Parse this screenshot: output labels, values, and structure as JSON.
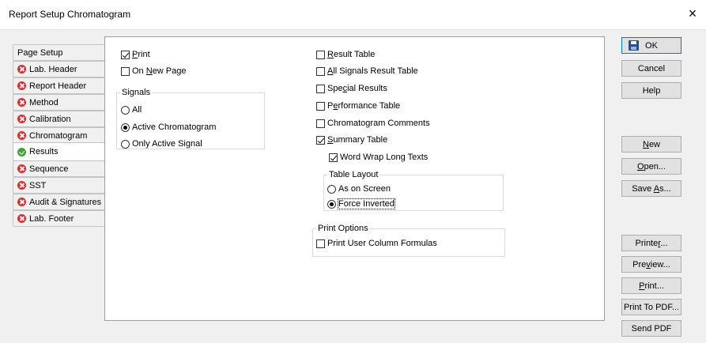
{
  "window": {
    "title": "Report Setup Chromatogram",
    "close_glyph": "×"
  },
  "tabs": [
    {
      "label": "Page Setup",
      "status": "none",
      "active": false
    },
    {
      "label": "Lab. Header",
      "status": "error",
      "active": false
    },
    {
      "label": "Report Header",
      "status": "error",
      "active": false
    },
    {
      "label": "Method",
      "status": "error",
      "active": false
    },
    {
      "label": "Calibration",
      "status": "error",
      "active": false
    },
    {
      "label": "Chromatogram",
      "status": "error",
      "active": false
    },
    {
      "label": "Results",
      "status": "ok",
      "active": true
    },
    {
      "label": "Sequence",
      "status": "error",
      "active": false
    },
    {
      "label": "SST",
      "status": "error",
      "active": false
    },
    {
      "label": "Audit & Signatures",
      "status": "error",
      "active": false
    },
    {
      "label": "Lab. Footer",
      "status": "error",
      "active": false
    }
  ],
  "left_options": {
    "print": {
      "label_u": "P",
      "label_rest": "rint",
      "checked": true
    },
    "on_new_page": {
      "label_pre": "On ",
      "label_u": "N",
      "label_rest": "ew Page",
      "checked": false
    }
  },
  "signals": {
    "title": "Signals",
    "options": [
      {
        "label": "All",
        "selected": false
      },
      {
        "label": "Active Chromatogram",
        "selected": true
      },
      {
        "label": "Only Active Signal",
        "selected": false
      }
    ]
  },
  "right_options": {
    "result_table": {
      "label_u": "R",
      "label_rest": "esult Table",
      "checked": false
    },
    "all_signals_result_table": {
      "label_u": "A",
      "label_rest": "ll Signals Result Table",
      "checked": false
    },
    "special_results": {
      "label_pre": "Spe",
      "label_u": "c",
      "label_rest": "ial Results",
      "checked": false
    },
    "performance_table": {
      "label_pre": "P",
      "label_u": "e",
      "label_rest": "rformance Table",
      "checked": false
    },
    "chromatogram_comments": {
      "label": "Chromatogram Comments",
      "checked": false
    },
    "summary_table": {
      "label_u": "S",
      "label_rest": "ummary Table",
      "checked": true
    },
    "word_wrap": {
      "label": "Word Wrap Long Texts",
      "checked": true
    }
  },
  "table_layout": {
    "title": "Table Layout",
    "options": [
      {
        "label": "As on Screen",
        "selected": false
      },
      {
        "label": "Force Inverted",
        "selected": true
      }
    ]
  },
  "print_options": {
    "title": "Print Options",
    "formulas": {
      "label": "Print User Column Formulas",
      "checked": false
    }
  },
  "buttons": {
    "ok": "OK",
    "cancel": "Cancel",
    "help": "Help",
    "new_u": "N",
    "new_rest": "ew",
    "open_u": "O",
    "open_rest": "pen...",
    "save_pre": "Save ",
    "save_u": "A",
    "save_rest": "s...",
    "printer_pre": "Printe",
    "printer_u": "r",
    "printer_rest": "...",
    "preview_pre": "Pre",
    "preview_u": "v",
    "preview_rest": "iew...",
    "print_u": "P",
    "print_rest": "rint...",
    "print_pdf": "Print To PDF...",
    "send_pdf": "Send PDF"
  },
  "icons": {
    "save": "save-disk-icon",
    "error": "error-x-icon",
    "ok": "ok-check-icon"
  }
}
